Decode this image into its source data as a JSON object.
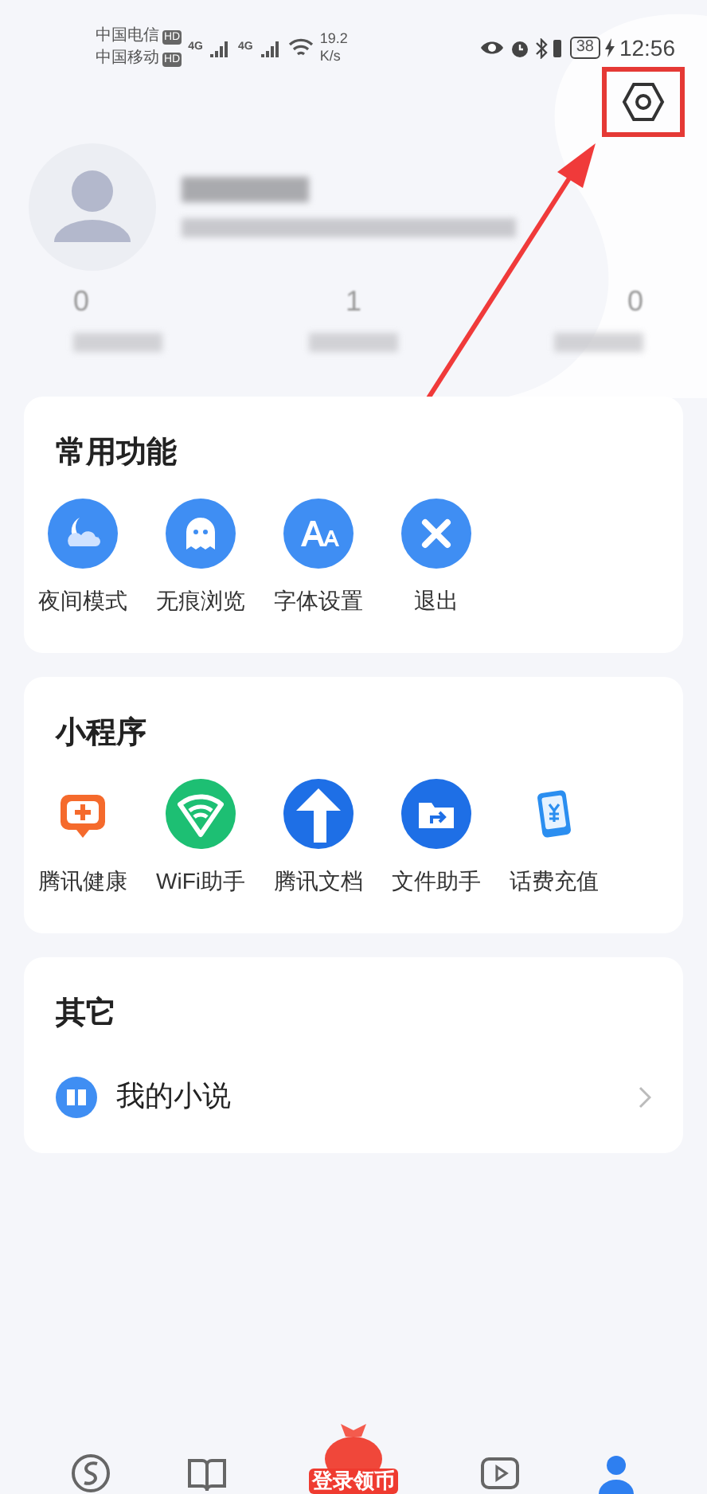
{
  "status_bar": {
    "carriers": [
      {
        "name": "中国电信",
        "badge": "HD"
      },
      {
        "name": "中国移动",
        "badge": "HD"
      }
    ],
    "networks": [
      "4G",
      "4G"
    ],
    "speed": "19.2",
    "speed_unit": "K/s",
    "battery": "38",
    "time": "12:56"
  },
  "profile": {
    "stats": [
      "0",
      "1",
      "0"
    ]
  },
  "sections": [
    {
      "title": "常用功能",
      "items": [
        {
          "label": "夜间模式"
        },
        {
          "label": "无痕浏览"
        },
        {
          "label": "字体设置"
        },
        {
          "label": "退出"
        }
      ]
    },
    {
      "title": "小程序",
      "items": [
        {
          "label": "腾讯健康"
        },
        {
          "label": "WiFi助手"
        },
        {
          "label": "腾讯文档"
        },
        {
          "label": "文件助手"
        },
        {
          "label": "话费充值"
        }
      ]
    },
    {
      "title": "其它",
      "rows": [
        {
          "label": "我的小说"
        }
      ]
    }
  ],
  "bottom_nav": {
    "promo": "登录领币"
  }
}
